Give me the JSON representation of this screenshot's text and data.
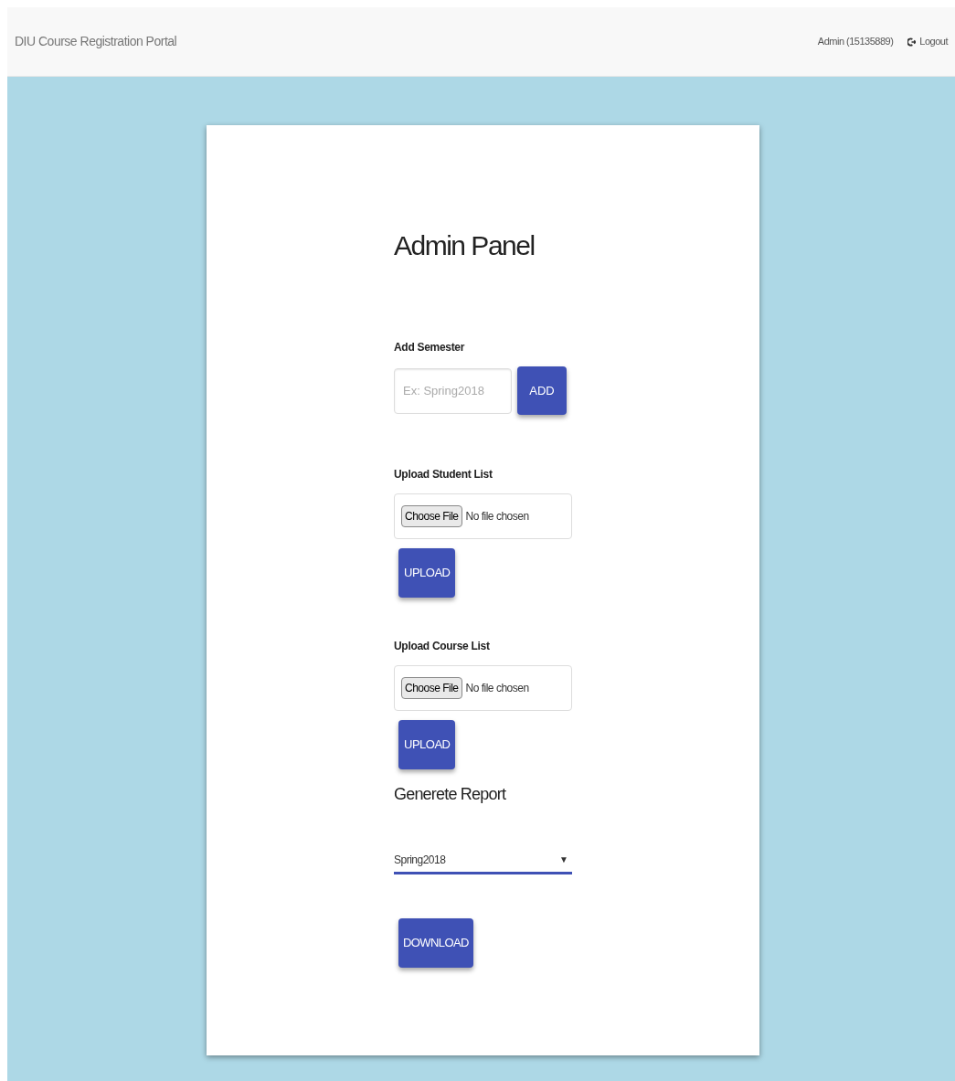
{
  "navbar": {
    "brand": "DIU Course Registration Portal",
    "user": "Admin (15135889)",
    "logout": "Logout"
  },
  "panel": {
    "title": "Admin Panel",
    "add_semester": {
      "label": "Add Semester",
      "placeholder": "Ex: Spring2018",
      "button": "ADD"
    },
    "uploads": [
      {
        "label": "Upload Student List",
        "choose": "Choose File",
        "status": "No file chosen",
        "button": "UPLOAD"
      },
      {
        "label": "Upload Course List",
        "choose": "Choose File",
        "status": "No file chosen",
        "button": "UPLOAD"
      }
    ],
    "report": {
      "title": "Generete Report",
      "value": "Spring2018",
      "arrow": "▼",
      "button": "DOWNLOAD"
    }
  }
}
